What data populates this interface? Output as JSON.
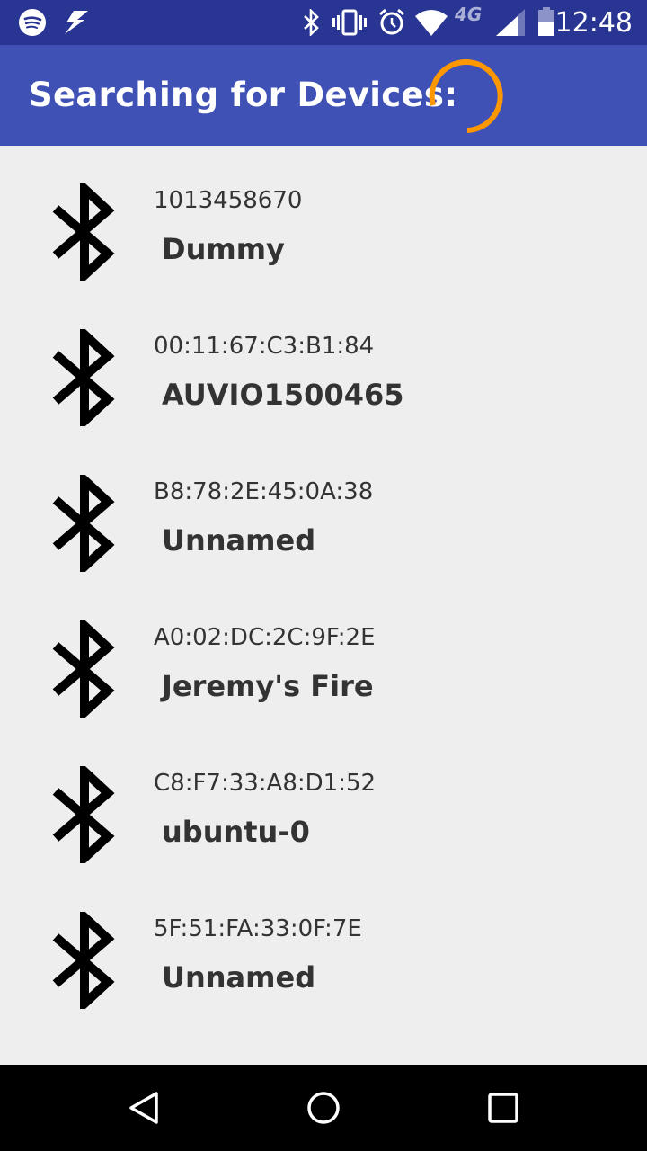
{
  "status_bar": {
    "time": "12:48",
    "network": "4G",
    "icons": [
      "spotify-icon",
      "flash-icon",
      "bluetooth-icon",
      "vibrate-icon",
      "alarm-icon",
      "wifi-icon",
      "signal-icon",
      "battery-icon"
    ]
  },
  "app_bar": {
    "title": "Searching for Devices:",
    "accent": "#ff9800",
    "color": "#3f51b5"
  },
  "devices": [
    {
      "address": "1013458670",
      "name": "Dummy"
    },
    {
      "address": "00:11:67:C3:B1:84",
      "name": "AUVIO1500465"
    },
    {
      "address": "B8:78:2E:45:0A:38",
      "name": "Unnamed"
    },
    {
      "address": "A0:02:DC:2C:9F:2E",
      "name": "Jeremy's Fire"
    },
    {
      "address": "C8:F7:33:A8:D1:52",
      "name": "ubuntu-0"
    },
    {
      "address": "5F:51:FA:33:0F:7E",
      "name": "Unnamed"
    }
  ],
  "nav_bar": {
    "buttons": [
      "back-icon",
      "home-icon",
      "recents-icon"
    ]
  }
}
